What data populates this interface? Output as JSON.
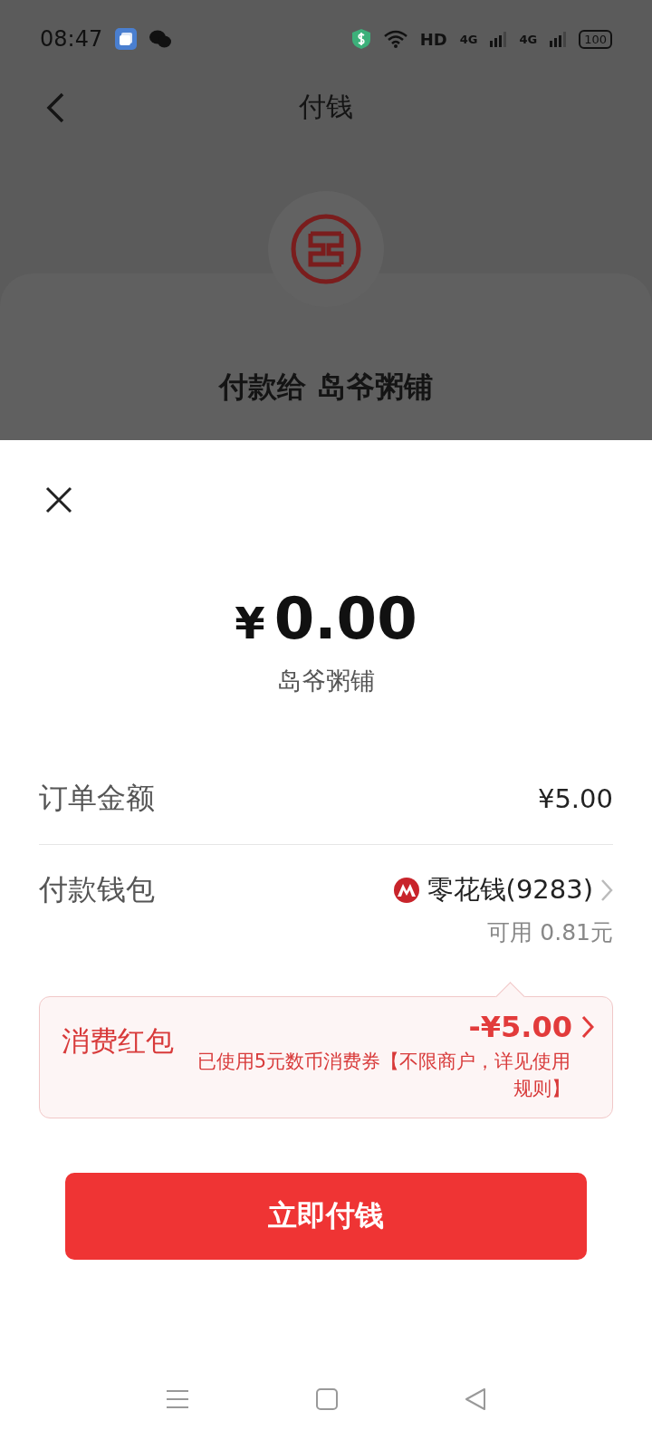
{
  "status_bar": {
    "time": "08:47",
    "network": "HD",
    "signals": [
      "4G",
      "4G"
    ],
    "battery": "100"
  },
  "header": {
    "title": "付钱"
  },
  "payee": {
    "text": "付款给 岛爷粥铺"
  },
  "sheet": {
    "currency": "¥",
    "amount": "0.00",
    "merchant": "岛爷粥铺",
    "rows": [
      {
        "kind": "amount",
        "label": "订单金额",
        "value": "¥5.00"
      },
      {
        "kind": "wallet",
        "label": "付款钱包",
        "value": "零花钱(9283)",
        "note": "可用 0.81元"
      }
    ],
    "coupon": {
      "label": "消费红包",
      "amount": "-¥5.00",
      "description": "已使用5元数币消费券【不限商户，详见使用规则】"
    },
    "button": "立即付钱"
  }
}
